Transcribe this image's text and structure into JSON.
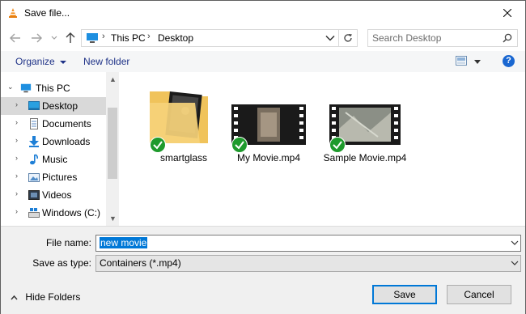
{
  "window": {
    "title": "Save file...",
    "accent": "#0078d7"
  },
  "titlebar": {
    "app_icon": "vlc-cone-icon",
    "close_icon": "close-icon"
  },
  "navigation": {
    "back_icon": "back-arrow-icon",
    "forward_icon": "forward-arrow-icon",
    "recent_icon": "chevron-down-icon",
    "up_icon": "up-arrow-icon"
  },
  "address": {
    "crumbs": [
      "This PC",
      "Desktop"
    ],
    "dropdown_icon": "chevron-down-icon",
    "refresh_icon": "refresh-icon"
  },
  "search": {
    "placeholder": "Search Desktop",
    "icon": "search-icon"
  },
  "toolbar": {
    "organize_label": "Organize",
    "new_folder_label": "New folder",
    "view_icon": "view-options-icon",
    "help_label": "?"
  },
  "sidebar": {
    "items": [
      {
        "label": "This PC",
        "icon": "computer-icon"
      },
      {
        "label": "Desktop",
        "icon": "desktop-icon",
        "selected": true
      },
      {
        "label": "Documents",
        "icon": "documents-icon"
      },
      {
        "label": "Downloads",
        "icon": "downloads-icon"
      },
      {
        "label": "Music",
        "icon": "music-icon"
      },
      {
        "label": "Pictures",
        "icon": "pictures-icon"
      },
      {
        "label": "Videos",
        "icon": "videos-icon"
      },
      {
        "label": "Windows (C:)",
        "icon": "drive-icon"
      }
    ]
  },
  "files": [
    {
      "name": "smartglass",
      "type": "folder"
    },
    {
      "name": "My Movie.mp4",
      "type": "video"
    },
    {
      "name": "Sample Movie.mp4",
      "type": "video"
    }
  ],
  "form": {
    "filename_label": "File name:",
    "filename_value": "new movie",
    "savetype_label": "Save as type:",
    "savetype_value": "Containers (*.mp4)"
  },
  "footer": {
    "hide_folders_label": "Hide Folders",
    "save_label": "Save",
    "cancel_label": "Cancel"
  }
}
